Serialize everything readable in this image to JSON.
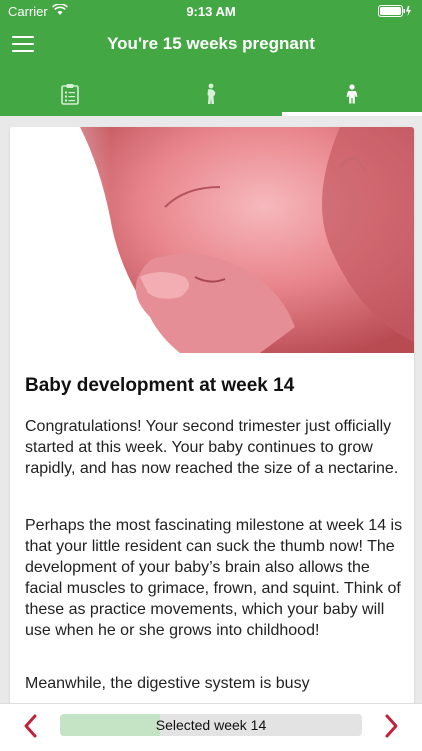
{
  "status": {
    "carrier": "Carrier",
    "time": "9:13 AM"
  },
  "header": {
    "title": "You're 15 weeks pregnant"
  },
  "tabs": [
    {
      "name": "checklist-tab",
      "icon": "clipboard-icon"
    },
    {
      "name": "mother-tab",
      "icon": "pregnant-woman-icon"
    },
    {
      "name": "baby-tab",
      "icon": "child-icon",
      "active": true
    }
  ],
  "article": {
    "heading": "Baby development at week 14",
    "paragraphs": [
      "Congratulations! Your second trimester just officially started at this week. Your baby continues to grow rapidly, and has now reached the size of a nectarine.",
      "Perhaps the most fascinating milestone at week 14 is that your little resident can suck the thumb now! The development of your baby’s brain also allows the facial muscles to grimace, frown, and squint. Think of these as practice movements, which your baby will use when he or she grows into childhood!",
      "Meanwhile, the digestive system is busy"
    ]
  },
  "navigator": {
    "label": "Selected week 14",
    "progress": 0.33,
    "prev_icon": "chevron-left-icon",
    "next_icon": "chevron-right-icon"
  },
  "colors": {
    "brand": "#43a843",
    "accent_arrow": "#c0223b",
    "progress_fill": "#c5e3c5"
  }
}
